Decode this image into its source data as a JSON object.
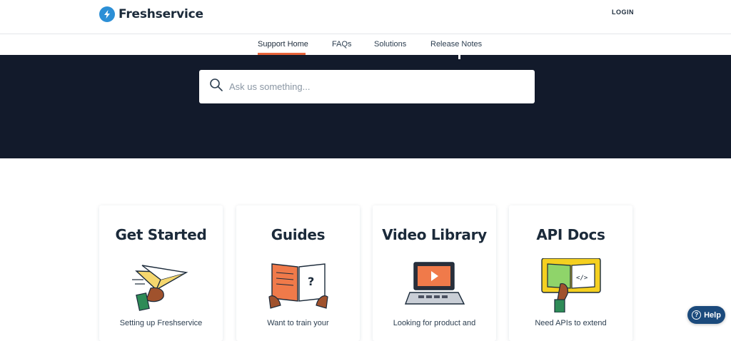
{
  "header": {
    "brand": "Freshservice",
    "login_label": "LOGIN"
  },
  "nav": {
    "items": [
      {
        "label": "Support Home"
      },
      {
        "label": "FAQs"
      },
      {
        "label": "Solutions"
      },
      {
        "label": "Release Notes"
      }
    ],
    "active_color": "#e8633a"
  },
  "hero": {
    "background_color": "#121a2b",
    "search_placeholder": "Ask us something..."
  },
  "cards": [
    {
      "title": "Get Started",
      "description": "Setting up Freshservice",
      "icon": "paper-plane-icon"
    },
    {
      "title": "Guides",
      "description": "Want to train your",
      "icon": "open-book-icon"
    },
    {
      "title": "Video Library",
      "description": "Looking for product and",
      "icon": "laptop-video-icon"
    },
    {
      "title": "API Docs",
      "description": "Need APIs to extend",
      "icon": "code-book-icon"
    }
  ],
  "help": {
    "label": "Help"
  }
}
